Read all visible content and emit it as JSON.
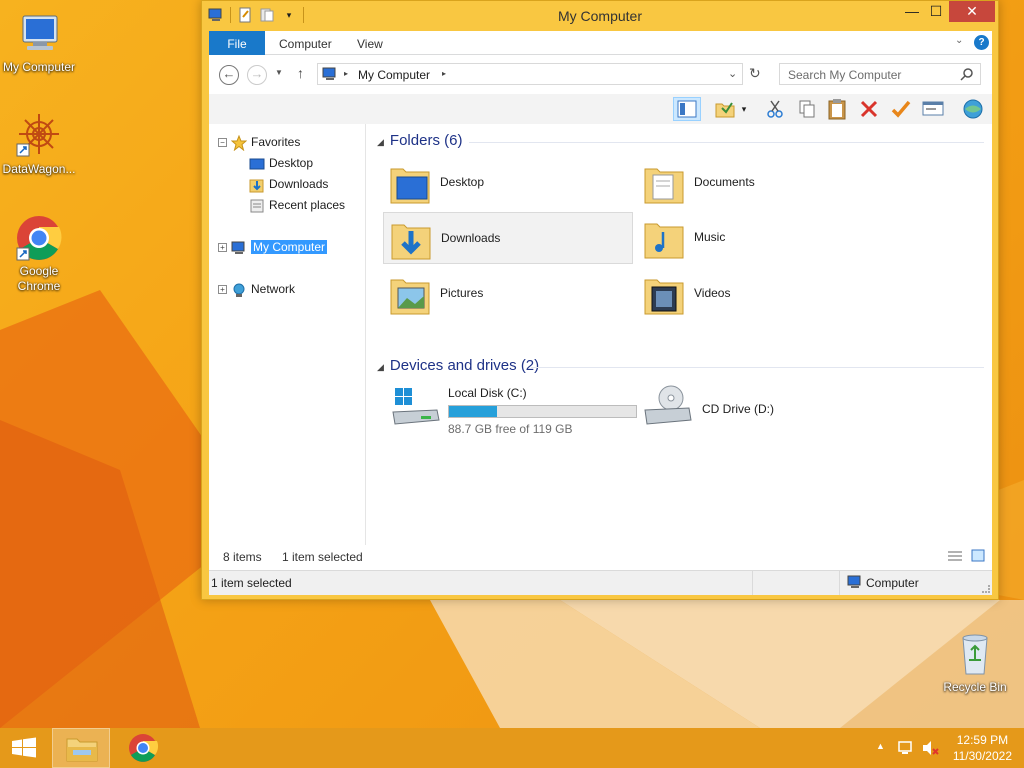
{
  "desktop": {
    "icons": [
      {
        "label": "My Computer"
      },
      {
        "label": "DataWagon..."
      },
      {
        "label": "Google Chrome"
      },
      {
        "label": "Recycle Bin"
      }
    ]
  },
  "window": {
    "title": "My Computer",
    "controls": {
      "minimize": "—",
      "maximize": "☐",
      "close": "✕"
    }
  },
  "ribbon": {
    "tabs": [
      {
        "label": "File"
      },
      {
        "label": "Computer"
      },
      {
        "label": "View"
      }
    ]
  },
  "address": {
    "path": "My Computer",
    "search_placeholder": "Search My Computer"
  },
  "nav": {
    "favorites": "Favorites",
    "desktop": "Desktop",
    "downloads": "Downloads",
    "recent": "Recent places",
    "my_computer": "My Computer",
    "network": "Network"
  },
  "content": {
    "folders_header": "Folders (6)",
    "folders": [
      {
        "label": "Desktop"
      },
      {
        "label": "Documents"
      },
      {
        "label": "Downloads"
      },
      {
        "label": "Music"
      },
      {
        "label": "Pictures"
      },
      {
        "label": "Videos"
      }
    ],
    "drives_header": "Devices and drives (2)",
    "drives": [
      {
        "label": "Local Disk (C:)",
        "free_text": "88.7 GB free of 119 GB",
        "used_fraction": 0.255
      },
      {
        "label": "CD Drive (D:)"
      }
    ]
  },
  "status": {
    "item_count": "8 items",
    "selected": "1 item selected",
    "bottom_left": "1 item selected",
    "bottom_right": "Computer"
  },
  "taskbar": {
    "time": "12:59 PM",
    "date": "11/30/2022"
  },
  "colors": {
    "accent": "#1979ca",
    "selection": "#3399ff",
    "window_frame": "#f9c741",
    "close_button": "#c7473c",
    "progress": "#26a0da",
    "group_header": "#1e3287"
  }
}
